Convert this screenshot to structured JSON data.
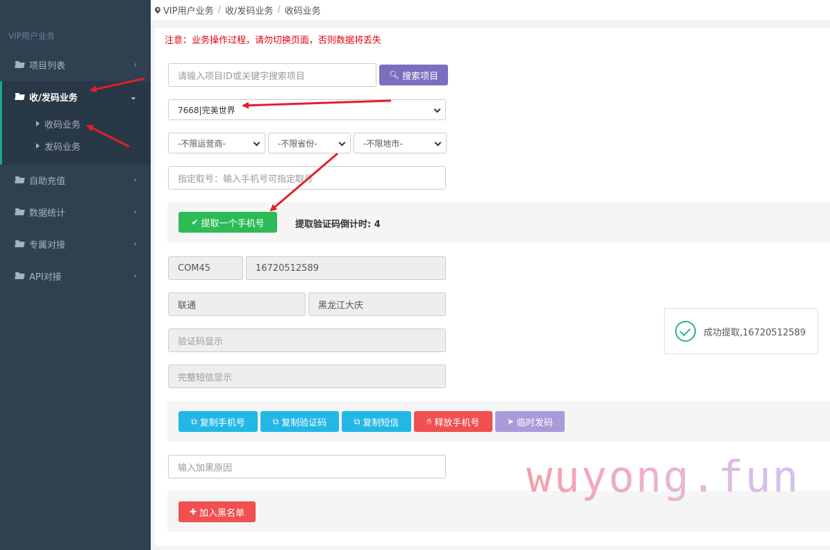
{
  "sidebar": {
    "title": "VIP用户业务",
    "items": [
      {
        "label": "项目列表"
      },
      {
        "label": "收/发码业务"
      },
      {
        "label": "自助充值"
      },
      {
        "label": "数据统计"
      },
      {
        "label": "专属对接"
      },
      {
        "label": "API对接"
      }
    ],
    "subitems": [
      {
        "label": "收码业务"
      },
      {
        "label": "发码业务"
      }
    ]
  },
  "breadcrumb": [
    "VIP用户业务",
    "收/发码业务",
    "收码业务"
  ],
  "notice": "注意：业务操作过程，请勿切换页面，否则数据将丢失",
  "search": {
    "placeholder": "请输入项目ID或关键字搜索项目",
    "button": "搜索项目"
  },
  "project_select": {
    "value": "7668|完美世界"
  },
  "filters": {
    "operator": "-不限运营商-",
    "province": "-不限省份-",
    "city": "-不限地市-"
  },
  "assign_number": {
    "placeholder": "指定取号：输入手机号可指定取号"
  },
  "fetch": {
    "button": "提取一个手机号",
    "countdown": "提取验证码倒计时: 4"
  },
  "result": {
    "port": "COM45",
    "phone": "16720512589",
    "carrier": "联通",
    "region": "黑龙江大庆",
    "code_placeholder": "验证码显示",
    "sms_placeholder": "完整短信显示"
  },
  "actions": {
    "copy_phone": "复制手机号",
    "copy_code": "复制验证码",
    "copy_sms": "复制短信",
    "release_phone": "释放手机号",
    "temp_send": "临时发码"
  },
  "blacklist": {
    "placeholder": "输入加黑原因",
    "button": "加入黑名单"
  },
  "toast": {
    "message": "成功提取,16720512589"
  },
  "watermark": "wuyong.fun",
  "colors": {
    "sidebar": "#2f4050",
    "notice": "#e3000b",
    "arrow": "#e0202a",
    "purple": "#7a6fbe",
    "green": "#2dbb57",
    "cyan": "#23b7e5",
    "red": "#f05050"
  }
}
